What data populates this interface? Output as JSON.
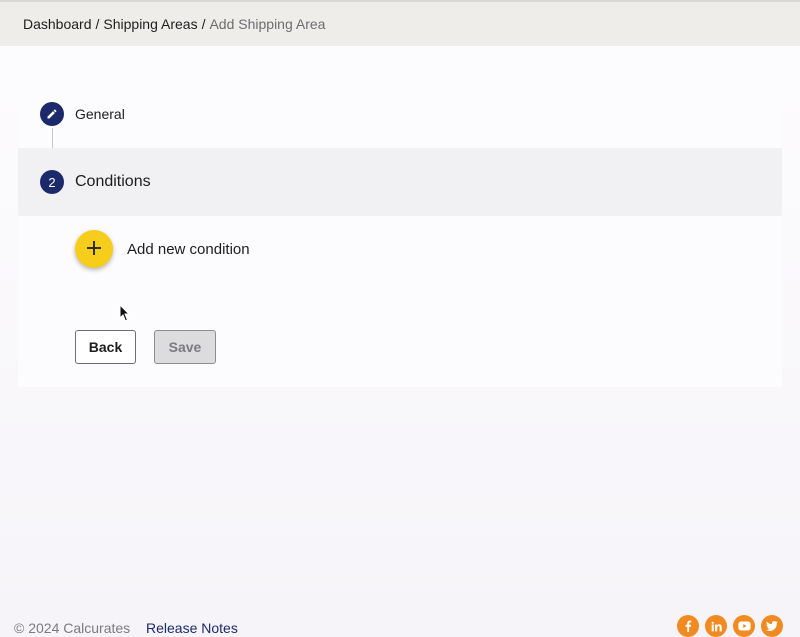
{
  "breadcrumb": {
    "items": [
      "Dashboard",
      "Shipping Areas"
    ],
    "separator": "/",
    "current": "Add Shipping Area"
  },
  "steps": [
    {
      "label": "General",
      "icon": "pencil-icon"
    },
    {
      "label": "Conditions",
      "number": "2"
    }
  ],
  "conditions": {
    "add_label": "Add new condition",
    "add_icon": "plus-icon"
  },
  "buttons": {
    "back": "Back",
    "save": "Save"
  },
  "footer": {
    "copyright": "© 2024 Calcurates",
    "release_notes": "Release Notes",
    "socials": [
      "facebook-icon",
      "linkedin-icon",
      "youtube-icon",
      "twitter-icon"
    ]
  },
  "colors": {
    "primary": "#1c2a6b",
    "accent_fab": "#f5cd1a",
    "social": "#f28a22"
  }
}
